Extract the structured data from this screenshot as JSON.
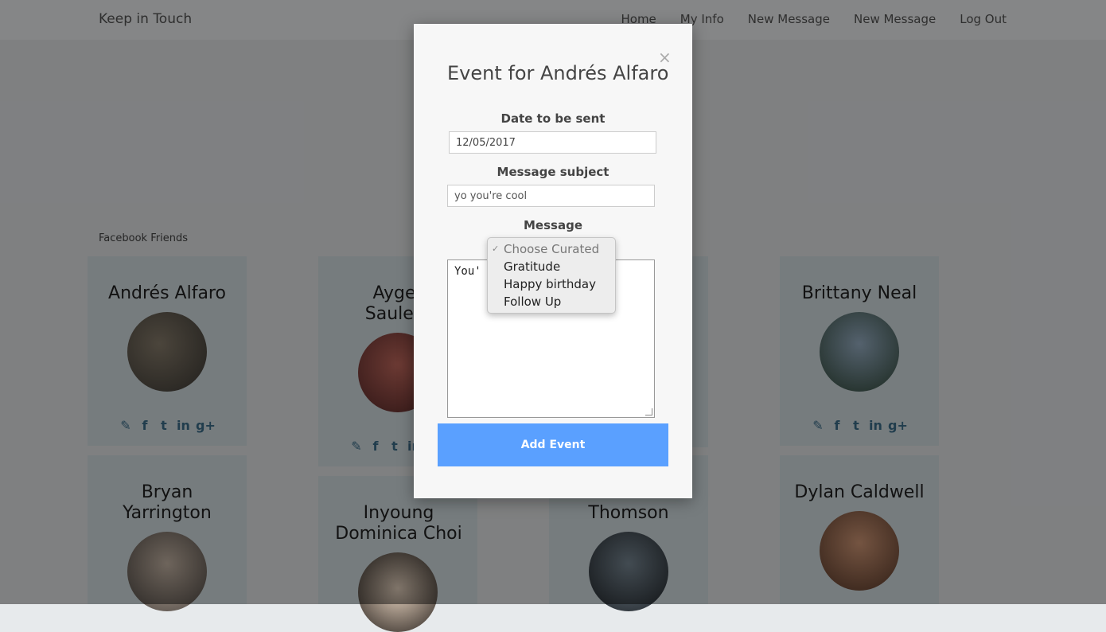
{
  "navbar": {
    "brand": "Keep in Touch",
    "links": [
      "Home",
      "My Info",
      "New Message",
      "New Message",
      "Log Out"
    ]
  },
  "section": {
    "title": "Facebook Friends"
  },
  "friends": [
    {
      "name": "Andrés Alfaro"
    },
    {
      "name": "Aygerim Sauletkyzy",
      "visible_name": "Ayger\nSauletk"
    },
    {
      "name": "Brittany Neal"
    },
    {
      "name": "Bryan Yarrington"
    },
    {
      "name": "Inyoung Dominica Choi"
    },
    {
      "name": "Cameron Colby Thomson",
      "visible_name": "Thomson"
    },
    {
      "name": "Dylan Caldwell"
    }
  ],
  "modal": {
    "title": "Event for Andrés Alfaro",
    "date_label": "Date to be sent",
    "date_value": "12/05/2017",
    "subject_label": "Message subject",
    "subject_value": "yo you're cool",
    "message_label": "Message",
    "message_value": "You'",
    "dropdown_options": [
      "Choose Curated",
      "Gratitude",
      "Happy birthday",
      "Follow Up"
    ],
    "submit_label": "Add Event",
    "close_symbol": "×"
  },
  "social_icons": [
    "edit-icon",
    "facebook-icon",
    "twitter-icon",
    "linkedin-icon",
    "google-plus-icon"
  ]
}
